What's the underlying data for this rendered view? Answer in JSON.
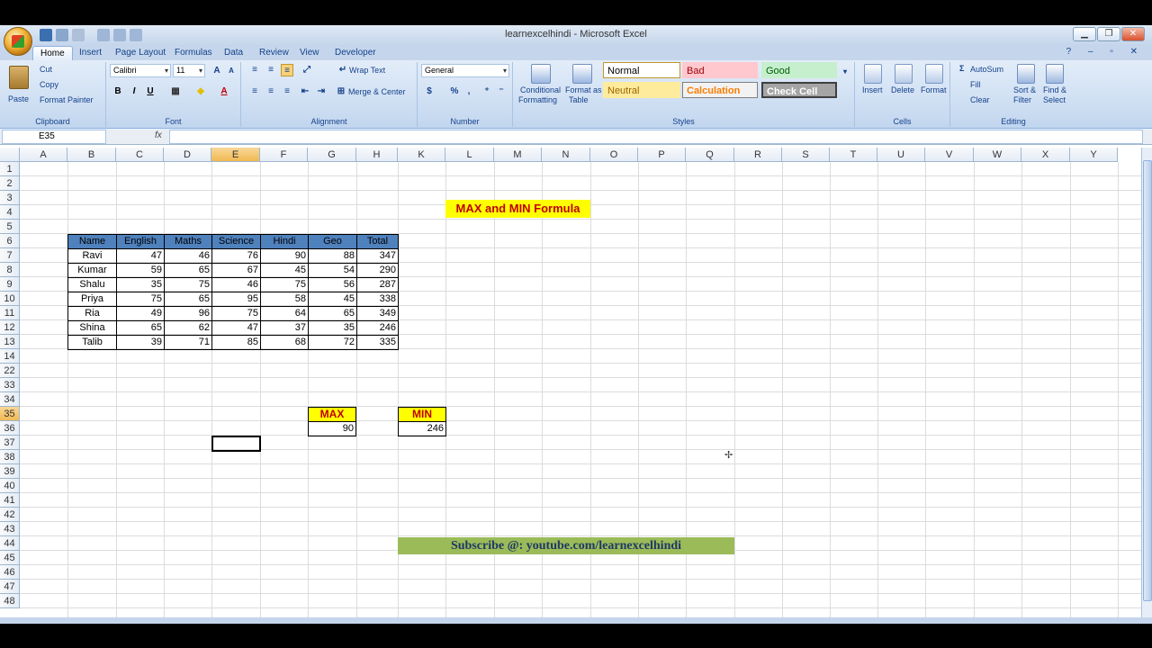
{
  "window": {
    "title": "learnexcelhindi - Microsoft Excel"
  },
  "tabs": [
    "Home",
    "Insert",
    "Page Layout",
    "Formulas",
    "Data",
    "Review",
    "View",
    "Developer"
  ],
  "ribbon": {
    "clipboard": {
      "paste": "Paste",
      "cut": "Cut",
      "copy": "Copy",
      "format_painter": "Format Painter",
      "label": "Clipboard"
    },
    "font": {
      "name": "Calibri",
      "size": "11",
      "label": "Font",
      "bold": "B",
      "italic": "I",
      "underline": "U"
    },
    "alignment": {
      "wrap": "Wrap Text",
      "merge": "Merge & Center",
      "label": "Alignment"
    },
    "number": {
      "format": "General",
      "label": "Number",
      "percent": "%",
      "comma": ","
    },
    "styles": {
      "conditional": "Conditional",
      "conditional2": "Formatting",
      "format_as": "Format as",
      "format_as2": "Table",
      "normal": "Normal",
      "bad": "Bad",
      "good": "Good",
      "neutral": "Neutral",
      "calculation": "Calculation",
      "check_cell": "Check Cell",
      "label": "Styles"
    },
    "cells": {
      "insert": "Insert",
      "delete": "Delete",
      "format": "Format",
      "label": "Cells"
    },
    "editing": {
      "autosum": "AutoSum",
      "fill": "Fill",
      "clear": "Clear",
      "sort": "Sort &",
      "sort2": "Filter",
      "find": "Find &",
      "find2": "Select",
      "label": "Editing"
    }
  },
  "formula_bar": {
    "name_box": "E35",
    "fx": "fx",
    "content": ""
  },
  "columns": [
    "A",
    "B",
    "C",
    "D",
    "E",
    "F",
    "G",
    "H",
    "K",
    "L",
    "M",
    "N",
    "O",
    "P",
    "Q",
    "R",
    "S",
    "T",
    "U",
    "V",
    "W",
    "X",
    "Y"
  ],
  "rows": [
    "1",
    "2",
    "3",
    "4",
    "5",
    "6",
    "7",
    "8",
    "9",
    "10",
    "11",
    "12",
    "13",
    "14",
    "22",
    "33",
    "34",
    "35",
    "36",
    "37",
    "38",
    "39",
    "40",
    "41",
    "42",
    "43",
    "44",
    "45",
    "46",
    "47",
    "48"
  ],
  "sheet": {
    "title": "MAX and MIN Formula",
    "table_headers": [
      "Name",
      "English",
      "Maths",
      "Science",
      "Hindi",
      "Geo",
      "Total"
    ],
    "table_rows": [
      [
        "Ravi",
        "47",
        "46",
        "76",
        "90",
        "88",
        "347"
      ],
      [
        "Kumar",
        "59",
        "65",
        "67",
        "45",
        "54",
        "290"
      ],
      [
        "Shalu",
        "35",
        "75",
        "46",
        "75",
        "56",
        "287"
      ],
      [
        "Priya",
        "75",
        "65",
        "95",
        "58",
        "45",
        "338"
      ],
      [
        "Ria",
        "49",
        "96",
        "75",
        "64",
        "65",
        "349"
      ],
      [
        "Shina",
        "65",
        "62",
        "47",
        "37",
        "35",
        "246"
      ],
      [
        "Talib",
        "39",
        "71",
        "85",
        "68",
        "72",
        "335"
      ]
    ],
    "max_label": "MAX",
    "max_value": "90",
    "min_label": "MIN",
    "min_value": "246",
    "subscribe": "Subscribe @: youtube.com/learnexcelhindi"
  },
  "colors": {
    "header_blue": "#4f81bd",
    "highlight_yellow": "#ffff00",
    "label_red": "#c00000",
    "banner_green": "#9bbb59"
  }
}
